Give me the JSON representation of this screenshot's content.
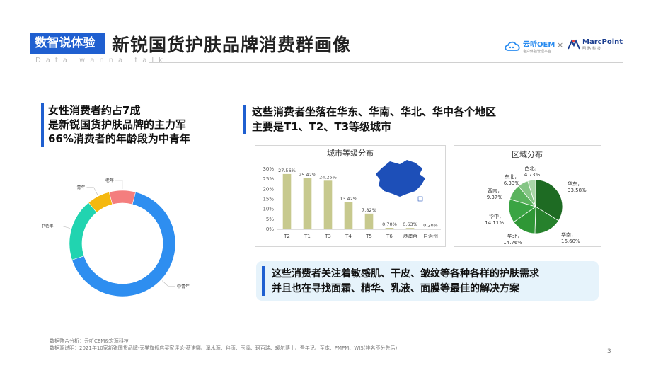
{
  "header": {
    "tag": "数智说体验",
    "title": "新锐国货护肤品牌消费群画像",
    "subtitle": "Data wanna talk",
    "logo_left": "云听OEM",
    "logo_left_sub": "客户体验管理平台",
    "logo_sep": "×",
    "logo_right": "MarcPoint",
    "logo_right_sub": "明略科技"
  },
  "left_block": {
    "lines": [
      "女性消费者约占7成",
      "是新锐国货护肤品牌的主力军",
      "66%消费者的年龄段为中青年"
    ]
  },
  "right_block": {
    "lines": [
      "这些消费者坐落在华东、华南、华北、华中各个地区",
      "主要是T1、T2、T3等级城市"
    ]
  },
  "callout": {
    "lines": [
      "这些消费者关注着敏感肌、干皮、皱纹等各种各样的护肤需求",
      "并且也在寻找面霜、精华、乳液、面膜等最佳的解决方案"
    ]
  },
  "footer": {
    "line1": "数据整合分析：云听CEM&宏源科技",
    "line2": "数据源说明：2021年10家新锐国货品牌-天猫旗舰店买家评论-薇诺娜、溪木源、谷雨、玉泽、珂百瑞、瑷尔博士、吾年记、至本、PMPM、WIS(排名不分先后)",
    "page": "3"
  },
  "chart_data": [
    {
      "type": "pie",
      "variant": "donut",
      "labels": [
        "中青年",
        "中老年",
        "青年",
        "老年"
      ],
      "values": [
        66,
        19,
        7,
        8
      ],
      "colors": [
        "#2e8ef0",
        "#21d4b0",
        "#f5b80f",
        "#f47e7e"
      ],
      "title": ""
    },
    {
      "type": "bar",
      "title": "城市等级分布",
      "categories": [
        "T2",
        "T1",
        "T3",
        "T4",
        "T5",
        "T6",
        "港澳台",
        "自治州"
      ],
      "values": [
        27.56,
        25.42,
        24.25,
        13.42,
        7.82,
        0.7,
        0.63,
        0.2
      ],
      "value_labels": [
        "27.56%",
        "25.42%",
        "24.25%",
        "13.42%",
        "7.82%",
        "0.70%",
        "0.63%",
        "0.20%"
      ],
      "ylim": [
        0,
        30
      ],
      "yticks": [
        "0%",
        "5%",
        "10%",
        "15%",
        "20%",
        "25%",
        "30%"
      ],
      "color": "#c7c98e"
    },
    {
      "type": "pie",
      "title": "区域分布",
      "labels": [
        "华东",
        "华南",
        "华北",
        "华中",
        "西南",
        "东北",
        "西北"
      ],
      "values": [
        33.58,
        16.6,
        14.76,
        14.11,
        9.37,
        6.33,
        4.73
      ],
      "value_labels": [
        "33.58%",
        "16.60%",
        "14.76%",
        "14.11%",
        "9.37%",
        "6.33%",
        "4.73%"
      ],
      "colors": [
        "#1e6b23",
        "#26812c",
        "#2f9736",
        "#3aa443",
        "#5bb35e",
        "#85c585",
        "#a9d6a7"
      ]
    }
  ]
}
